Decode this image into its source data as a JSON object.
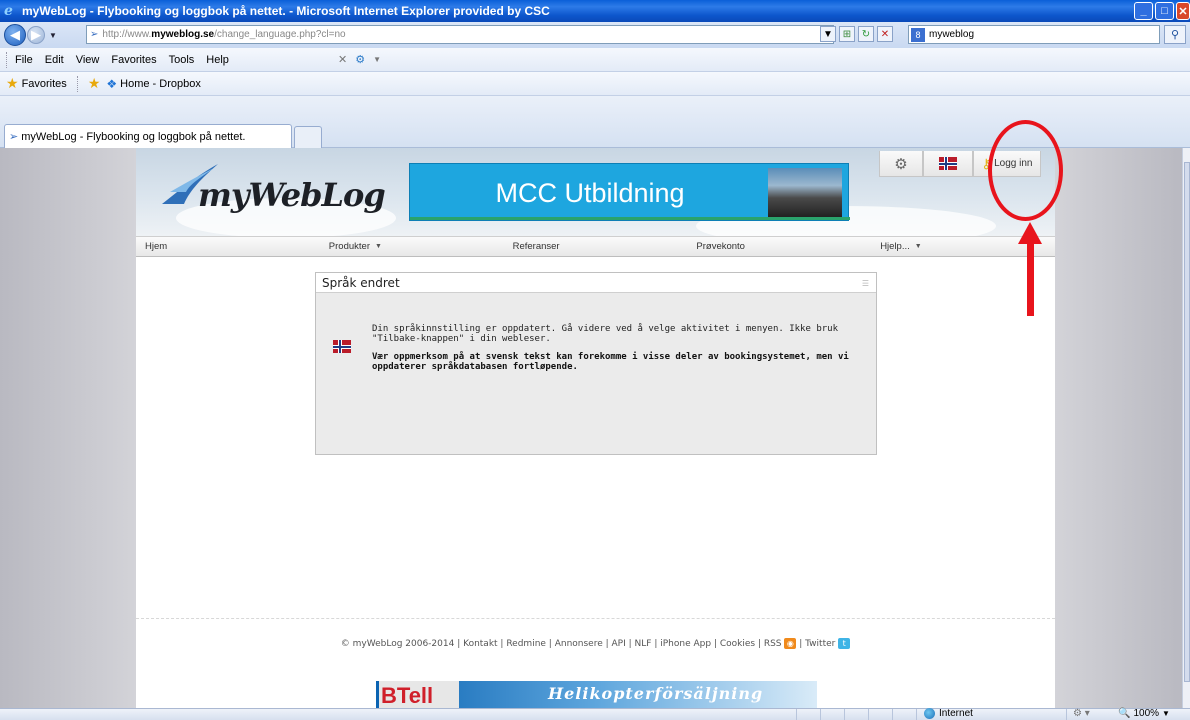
{
  "window": {
    "title": "myWebLog - Flybooking og loggbok på nettet. - Microsoft Internet Explorer provided by CSC"
  },
  "addressbar": {
    "url_prefix": "http://www.",
    "url_domain": "myweblog.se",
    "url_path": "/change_language.php?cl=no",
    "search_value": "myweblog"
  },
  "menubar": {
    "items": [
      "File",
      "Edit",
      "View",
      "Favorites",
      "Tools",
      "Help"
    ]
  },
  "favoritesbar": {
    "favorites_label": "Favorites",
    "link_label": "Home - Dropbox"
  },
  "tabs": [
    {
      "label": "myWebLog - Flybooking og loggbok på nettet."
    }
  ],
  "site": {
    "logo_text": "myWebLog",
    "banner_text": "MCC Utbildning",
    "login_label": "Logg inn",
    "nav": [
      {
        "label": "Hjem",
        "has_caret": false
      },
      {
        "label": "Produkter",
        "has_caret": true
      },
      {
        "label": "Referanser",
        "has_caret": false
      },
      {
        "label": "Prøvekonto",
        "has_caret": false
      },
      {
        "label": "Hjelp...",
        "has_caret": true
      }
    ],
    "caret": "▼",
    "panel": {
      "title": "Språk endret",
      "message": "Din språkinnstilling er oppdatert. Gå videre ved å velge aktivitet i menyen. Ikke bruk \"Tilbake-knappen\" i din webleser.",
      "notice": "Vær oppmerksom på at svensk tekst kan forekomme i visse deler av bookingsystemet, men vi oppdaterer språkdatabasen fortløpende."
    },
    "footer": {
      "copyright": "© myWebLog 2006-2014",
      "links": [
        "Kontakt",
        "Redmine",
        "Annonsere",
        "API",
        "NLF",
        "iPhone App",
        "Cookies",
        "RSS",
        "Twitter"
      ]
    },
    "ad": {
      "brand": "BTell",
      "text": "Helikopterförsäljning"
    }
  },
  "statusbar": {
    "zone": "Internet",
    "zoom": "100%"
  },
  "colors": {
    "annotation": "#e8141c",
    "banner": "#1ea6df",
    "titlebar": "#0a5fd8"
  }
}
